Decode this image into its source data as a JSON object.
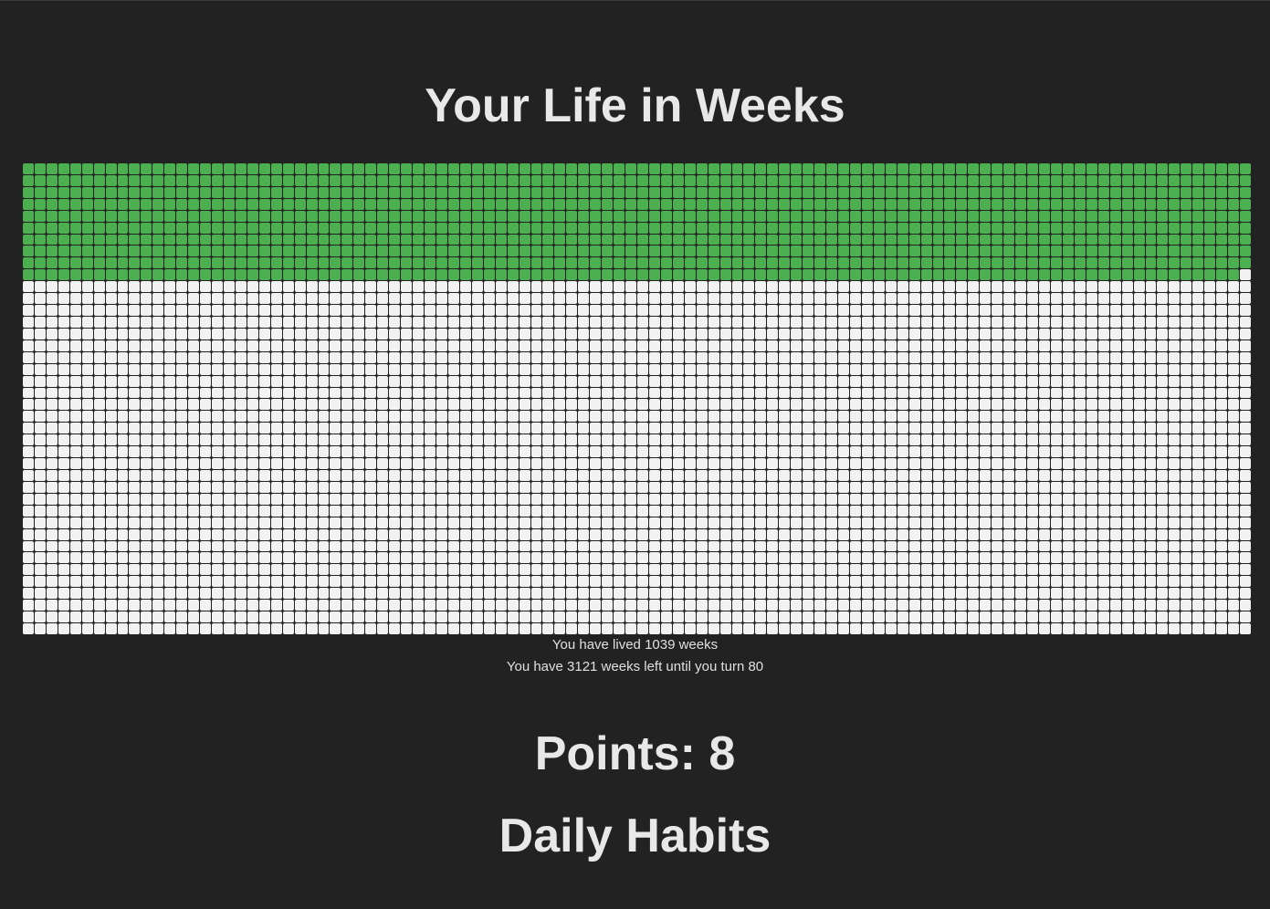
{
  "page": {
    "title": "Your Life in Weeks"
  },
  "life_grid": {
    "weeks_lived": 1039,
    "total_weeks": 4160,
    "lived_color": "#4caf50",
    "remaining_color": "#f2f2f2"
  },
  "stats": {
    "lived_text": "You have lived 1039 weeks",
    "left_text": "You have 3121 weeks left until you turn 80"
  },
  "points": {
    "label": "Points: 8"
  },
  "habits": {
    "title": "Daily Habits"
  }
}
